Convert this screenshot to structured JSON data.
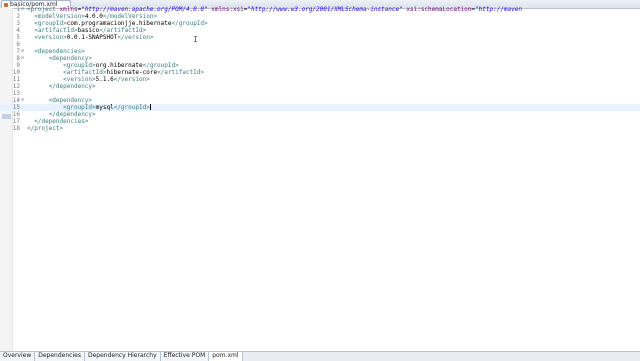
{
  "editor": {
    "tab_label": "basico/pom.xml",
    "lines": [
      {
        "n": "1",
        "fold": "⊖",
        "parts": [
          [
            "tag",
            "<project "
          ],
          [
            "att",
            "xmlns"
          ],
          [
            "txt",
            "="
          ],
          [
            "val",
            "\"http://maven.apache.org/POM/4.0.0\""
          ],
          [
            "txt",
            " "
          ],
          [
            "att",
            "xmlns:xsi"
          ],
          [
            "txt",
            "="
          ],
          [
            "val",
            "\"http://www.w3.org/2001/XMLSchema-instance\""
          ],
          [
            "txt",
            " "
          ],
          [
            "att",
            "xsi:schemaLocation"
          ],
          [
            "txt",
            "="
          ],
          [
            "val",
            "\"http://maven"
          ]
        ]
      },
      {
        "n": "2",
        "fold": "",
        "parts": [
          [
            "txt",
            "  "
          ],
          [
            "tag",
            "<modelVersion>"
          ],
          [
            "txt",
            "4.0.0"
          ],
          [
            "tag",
            "</modelVersion>"
          ]
        ]
      },
      {
        "n": "3",
        "fold": "",
        "parts": [
          [
            "txt",
            "  "
          ],
          [
            "tag",
            "<groupId>"
          ],
          [
            "txt",
            "com.programacionjje.hibernate"
          ],
          [
            "tag",
            "</groupId>"
          ]
        ]
      },
      {
        "n": "4",
        "fold": "",
        "parts": [
          [
            "txt",
            "  "
          ],
          [
            "tag",
            "<artifactId>"
          ],
          [
            "txt",
            "basico"
          ],
          [
            "tag",
            "</artifactId>"
          ]
        ]
      },
      {
        "n": "5",
        "fold": "",
        "parts": [
          [
            "txt",
            "  "
          ],
          [
            "tag",
            "<version>"
          ],
          [
            "txt",
            "0.0.1-SNAPSHOT"
          ],
          [
            "tag",
            "</version>"
          ]
        ]
      },
      {
        "n": "6",
        "fold": "",
        "parts": []
      },
      {
        "n": "7",
        "fold": "⊖",
        "parts": [
          [
            "txt",
            "  "
          ],
          [
            "tag",
            "<dependencies>"
          ]
        ]
      },
      {
        "n": "8",
        "fold": "⊖",
        "parts": [
          [
            "txt",
            "      "
          ],
          [
            "tag",
            "<dependency>"
          ]
        ]
      },
      {
        "n": "9",
        "fold": "",
        "parts": [
          [
            "txt",
            "          "
          ],
          [
            "tag",
            "<groupId>"
          ],
          [
            "txt",
            "org.hibernate"
          ],
          [
            "tag",
            "</groupId>"
          ]
        ]
      },
      {
        "n": "10",
        "fold": "",
        "parts": [
          [
            "txt",
            "          "
          ],
          [
            "tag",
            "<artifactId>"
          ],
          [
            "txt",
            "hibernate-core"
          ],
          [
            "tag",
            "</artifactId>"
          ]
        ]
      },
      {
        "n": "11",
        "fold": "",
        "parts": [
          [
            "txt",
            "          "
          ],
          [
            "tag",
            "<version>"
          ],
          [
            "txt",
            "5.1.6"
          ],
          [
            "tag",
            "</version>"
          ]
        ]
      },
      {
        "n": "12",
        "fold": "",
        "parts": [
          [
            "txt",
            "      "
          ],
          [
            "tag",
            "</dependency>"
          ]
        ]
      },
      {
        "n": "13",
        "fold": "",
        "parts": []
      },
      {
        "n": "14",
        "fold": "⊖",
        "parts": [
          [
            "txt",
            "      "
          ],
          [
            "tag",
            "<dependency>"
          ]
        ]
      },
      {
        "n": "15",
        "fold": "",
        "parts": [
          [
            "txt",
            "          "
          ],
          [
            "tag",
            "<groupId>"
          ],
          [
            "txt",
            "mysql"
          ],
          [
            "tag",
            "</groupId>"
          ]
        ]
      },
      {
        "n": "16",
        "fold": "",
        "parts": [
          [
            "txt",
            "      "
          ],
          [
            "tag",
            "</dependency>"
          ]
        ]
      },
      {
        "n": "17",
        "fold": "",
        "parts": [
          [
            "txt",
            "  "
          ],
          [
            "tag",
            "</dependencies>"
          ]
        ]
      },
      {
        "n": "18",
        "fold": "",
        "parts": [
          [
            "tag",
            "</project>"
          ]
        ]
      }
    ],
    "current_line": "15",
    "mouse_cursor": "I"
  },
  "bottom_tabs": [
    "Overview",
    "Dependencies",
    "Dependency Hierarchy",
    "Effective POM",
    "pom.xml"
  ],
  "active_bottom_tab": "pom.xml",
  "colors": {
    "tag": "#3f7f7f",
    "attribute": "#7f007f",
    "value": "#2a00ff",
    "text": "#000000",
    "current_line": "#e8f2fe"
  }
}
